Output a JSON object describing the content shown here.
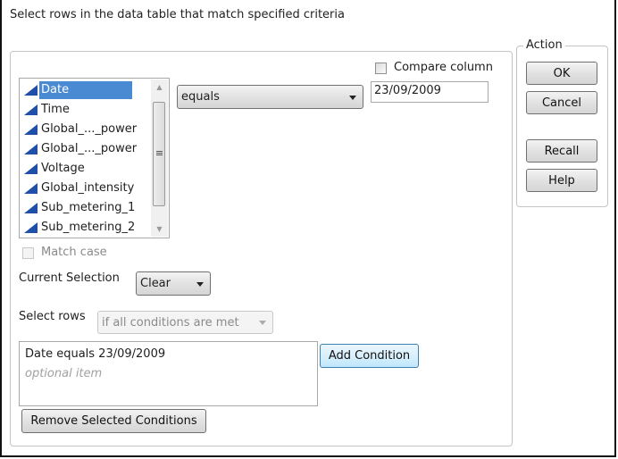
{
  "dialog": {
    "title": "Select rows in the data table that match specified criteria"
  },
  "columns": {
    "items": [
      {
        "label": "Date",
        "selected": true,
        "icon": "continuous-column-icon"
      },
      {
        "label": "Time",
        "selected": false,
        "icon": "continuous-column-icon"
      },
      {
        "label": "Global_..._power",
        "selected": false,
        "icon": "continuous-column-icon"
      },
      {
        "label": "Global_..._power",
        "selected": false,
        "icon": "continuous-column-icon"
      },
      {
        "label": "Voltage",
        "selected": false,
        "icon": "continuous-column-icon"
      },
      {
        "label": "Global_intensity",
        "selected": false,
        "icon": "continuous-column-icon"
      },
      {
        "label": "Sub_metering_1",
        "selected": false,
        "icon": "continuous-column-icon"
      },
      {
        "label": "Sub_metering_2",
        "selected": false,
        "icon": "continuous-column-icon"
      }
    ],
    "accent_color": "#4a8ad2"
  },
  "criteria": {
    "operator": "equals",
    "compare_column_label": "Compare column",
    "compare_column_checked": false,
    "value": "23/09/2009",
    "match_case_label": "Match case",
    "match_case_checked": false
  },
  "selection": {
    "current_selection_label": "Current Selection",
    "current_selection_value": "Clear",
    "select_rows_label": "Select rows",
    "select_rows_value": "if all conditions are met"
  },
  "conditions": {
    "items": [
      "Date equals 23/09/2009"
    ],
    "placeholder": "optional item",
    "add_label": "Add Condition",
    "remove_label": "Remove Selected Conditions"
  },
  "action": {
    "legend": "Action",
    "ok": "OK",
    "cancel": "Cancel",
    "recall": "Recall",
    "help": "Help"
  }
}
